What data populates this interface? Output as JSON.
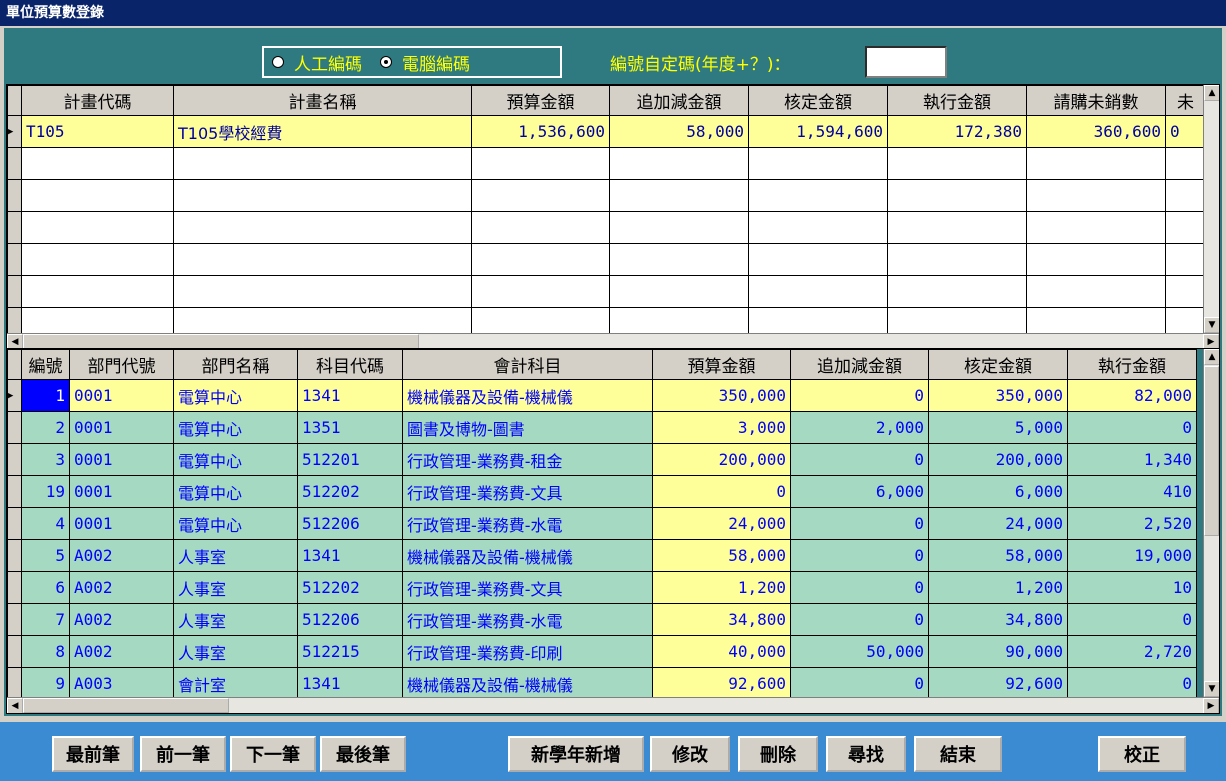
{
  "window": {
    "title": "單位預算數登錄"
  },
  "code_mode": {
    "options": [
      {
        "label": "人工編碼",
        "selected": false
      },
      {
        "label": "電腦編碼",
        "selected": true
      }
    ],
    "custom_label": "編號自定碼(年度+？)：",
    "custom_value": ""
  },
  "plans_table": {
    "columns": [
      "計畫代碼",
      "計畫名稱",
      "預算金額",
      "追加減金額",
      "核定金額",
      "執行金額",
      "請購未銷數",
      "未"
    ],
    "rows": [
      [
        "T105",
        "T105學校經費",
        "1,536,600",
        "58,000",
        "1,594,600",
        "172,380",
        "360,600",
        "0"
      ]
    ]
  },
  "detail_table": {
    "columns": [
      "編號",
      "部門代號",
      "部門名稱",
      "科目代碼",
      "會計科目",
      "預算金額",
      "追加減金額",
      "核定金額",
      "執行金額"
    ],
    "rows": [
      [
        "1",
        "0001",
        "電算中心",
        "1341",
        "機械儀器及設備-機械儀",
        "350,000",
        "0",
        "350,000",
        "82,000"
      ],
      [
        "2",
        "0001",
        "電算中心",
        "1351",
        "圖書及博物-圖書",
        "3,000",
        "2,000",
        "5,000",
        "0"
      ],
      [
        "3",
        "0001",
        "電算中心",
        "512201",
        "行政管理-業務費-租金",
        "200,000",
        "0",
        "200,000",
        "1,340"
      ],
      [
        "19",
        "0001",
        "電算中心",
        "512202",
        "行政管理-業務費-文具",
        "0",
        "6,000",
        "6,000",
        "410"
      ],
      [
        "4",
        "0001",
        "電算中心",
        "512206",
        "行政管理-業務費-水電",
        "24,000",
        "0",
        "24,000",
        "2,520"
      ],
      [
        "5",
        "A002",
        "人事室",
        "1341",
        "機械儀器及設備-機械儀",
        "58,000",
        "0",
        "58,000",
        "19,000"
      ],
      [
        "6",
        "A002",
        "人事室",
        "512202",
        "行政管理-業務費-文具",
        "1,200",
        "0",
        "1,200",
        "10"
      ],
      [
        "7",
        "A002",
        "人事室",
        "512206",
        "行政管理-業務費-水電",
        "34,800",
        "0",
        "34,800",
        "0"
      ],
      [
        "8",
        "A002",
        "人事室",
        "512215",
        "行政管理-業務費-印刷",
        "40,000",
        "50,000",
        "90,000",
        "2,720"
      ],
      [
        "9",
        "A003",
        "會計室",
        "1341",
        "機械儀器及設備-機械儀",
        "92,600",
        "0",
        "92,600",
        "0"
      ]
    ]
  },
  "buttons": {
    "first": "最前筆",
    "prev": "前一筆",
    "next": "下一筆",
    "last": "最後筆",
    "new_year": "新學年新增",
    "edit": "修改",
    "delete": "刪除",
    "find": "尋找",
    "exit": "結束",
    "correct": "校正"
  }
}
